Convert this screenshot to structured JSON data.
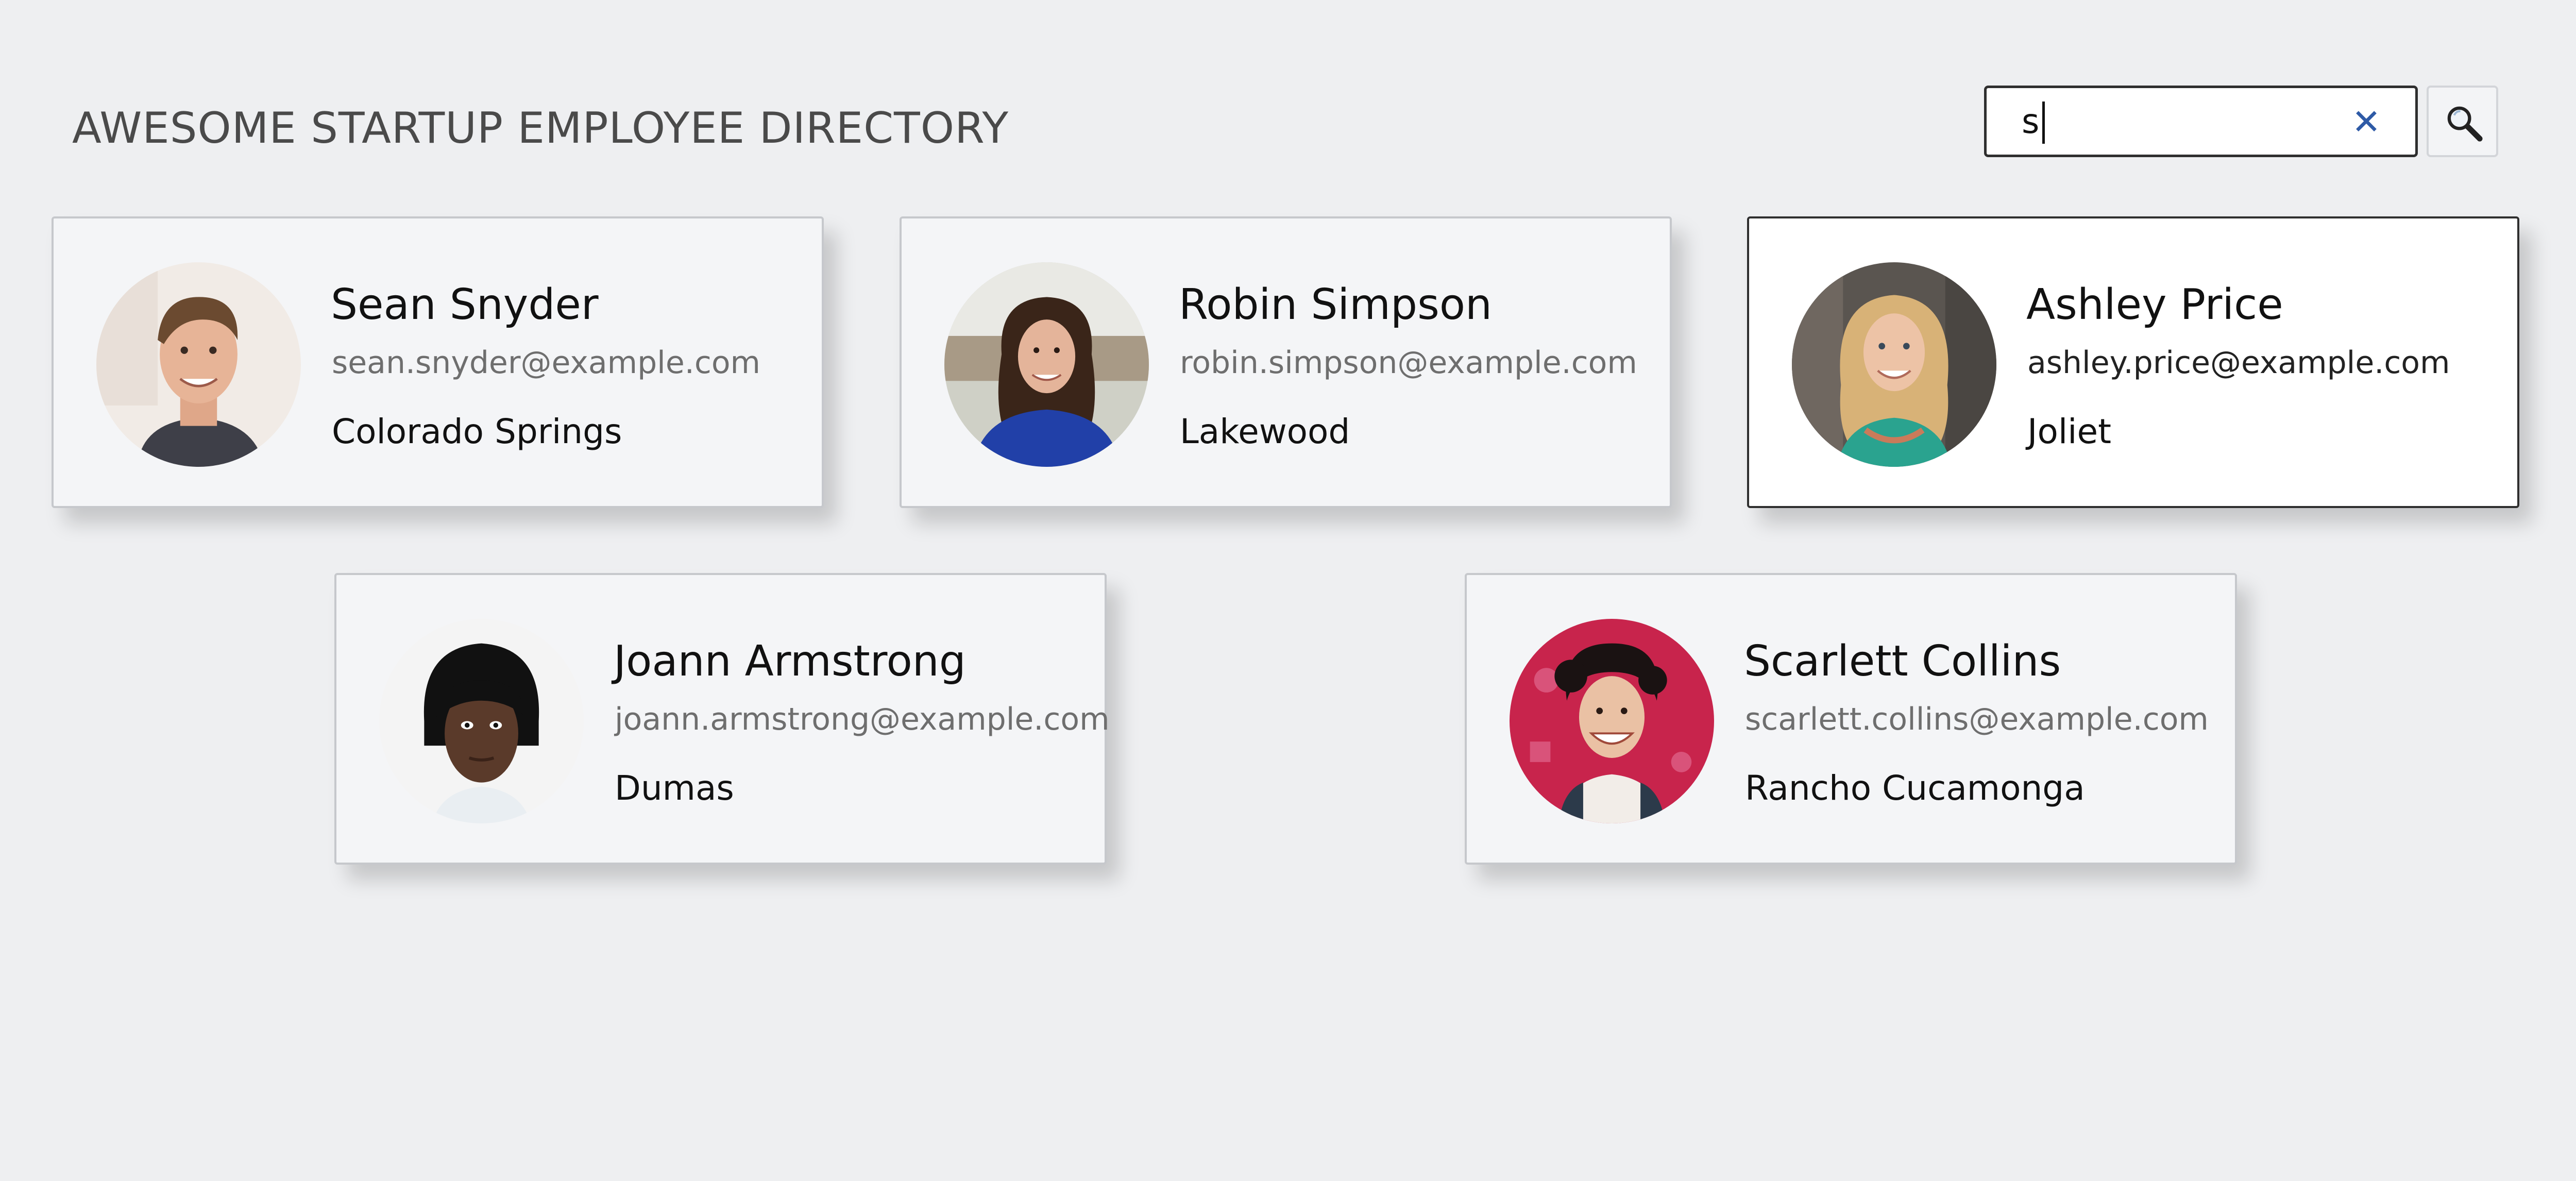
{
  "header": {
    "title": "AWESOME STARTUP EMPLOYEE DIRECTORY"
  },
  "search": {
    "value": "s",
    "clear_icon": "close-icon",
    "button_icon": "search-icon"
  },
  "colors": {
    "background": "#eeeff1",
    "accent": "#2e5aa6",
    "card_bg": "#f4f5f7",
    "card_highlight_bg": "#ffffff"
  },
  "employees": [
    {
      "name": "Sean Snyder",
      "email": "sean.snyder@example.com",
      "city": "Colorado Springs"
    },
    {
      "name": "Robin Simpson",
      "email": "robin.simpson@example.com",
      "city": "Lakewood"
    },
    {
      "name": "Ashley Price",
      "email": "ashley.price@example.com",
      "city": "Joliet"
    },
    {
      "name": "Joann Armstrong",
      "email": "joann.armstrong@example.com",
      "city": "Dumas"
    },
    {
      "name": "Scarlett Collins",
      "email": "scarlett.collins@example.com",
      "city": "Rancho Cucamonga"
    }
  ]
}
